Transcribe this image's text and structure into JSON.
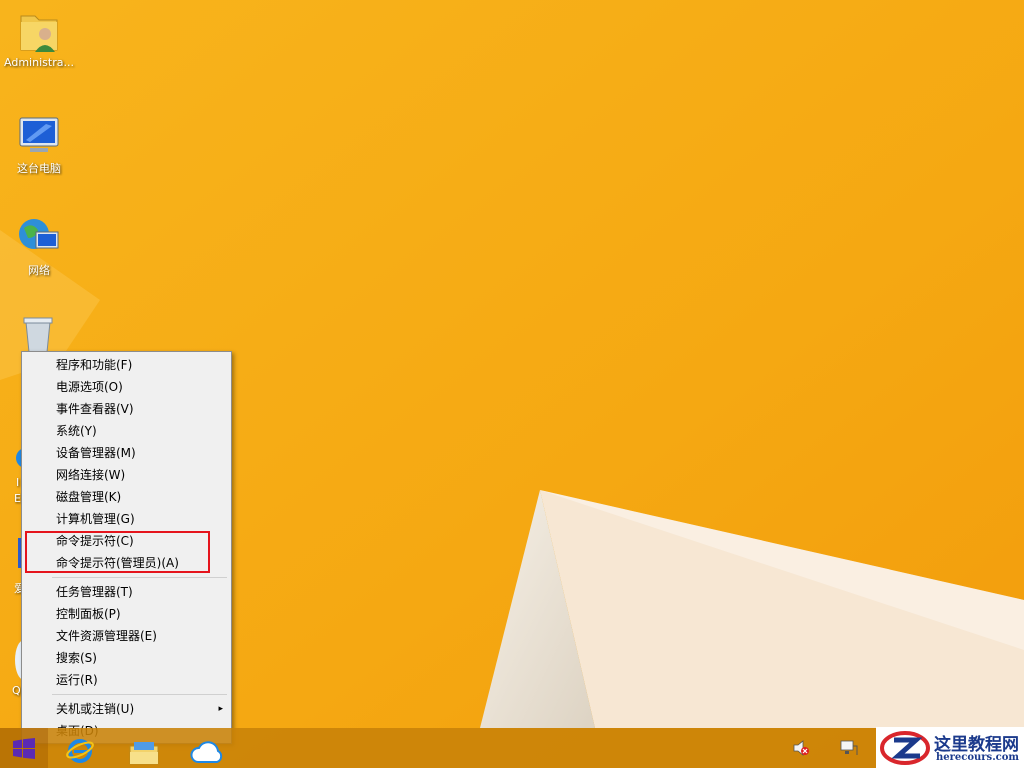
{
  "desktop": {
    "icons": [
      {
        "label": "Administra..."
      },
      {
        "label": "这台电脑"
      },
      {
        "label": "网络"
      }
    ],
    "partial_labels": [
      "I",
      "E",
      "爱",
      "Q"
    ]
  },
  "context_menu": {
    "groups": [
      [
        {
          "label": "程序和功能(F)"
        },
        {
          "label": "电源选项(O)"
        },
        {
          "label": "事件查看器(V)"
        },
        {
          "label": "系统(Y)"
        },
        {
          "label": "设备管理器(M)"
        },
        {
          "label": "网络连接(W)"
        },
        {
          "label": "磁盘管理(K)"
        },
        {
          "label": "计算机管理(G)"
        },
        {
          "label": "命令提示符(C)"
        },
        {
          "label": "命令提示符(管理员)(A)"
        }
      ],
      [
        {
          "label": "任务管理器(T)"
        },
        {
          "label": "控制面板(P)"
        },
        {
          "label": "文件资源管理器(E)"
        },
        {
          "label": "搜索(S)"
        },
        {
          "label": "运行(R)"
        }
      ],
      [
        {
          "label": "关机或注销(U)",
          "submenu_arrow": "▸"
        },
        {
          "label": "桌面(D)"
        }
      ]
    ]
  },
  "watermark": {
    "title": "这里教程网",
    "url": "herecours.com"
  },
  "colors": {
    "wallpaper": "#f6ad17",
    "menu_background": "#f0f0f0",
    "highlight_border": "#e5141c",
    "start_tile": "#5b2ab3",
    "watermark_text": "#1b3a8c"
  }
}
